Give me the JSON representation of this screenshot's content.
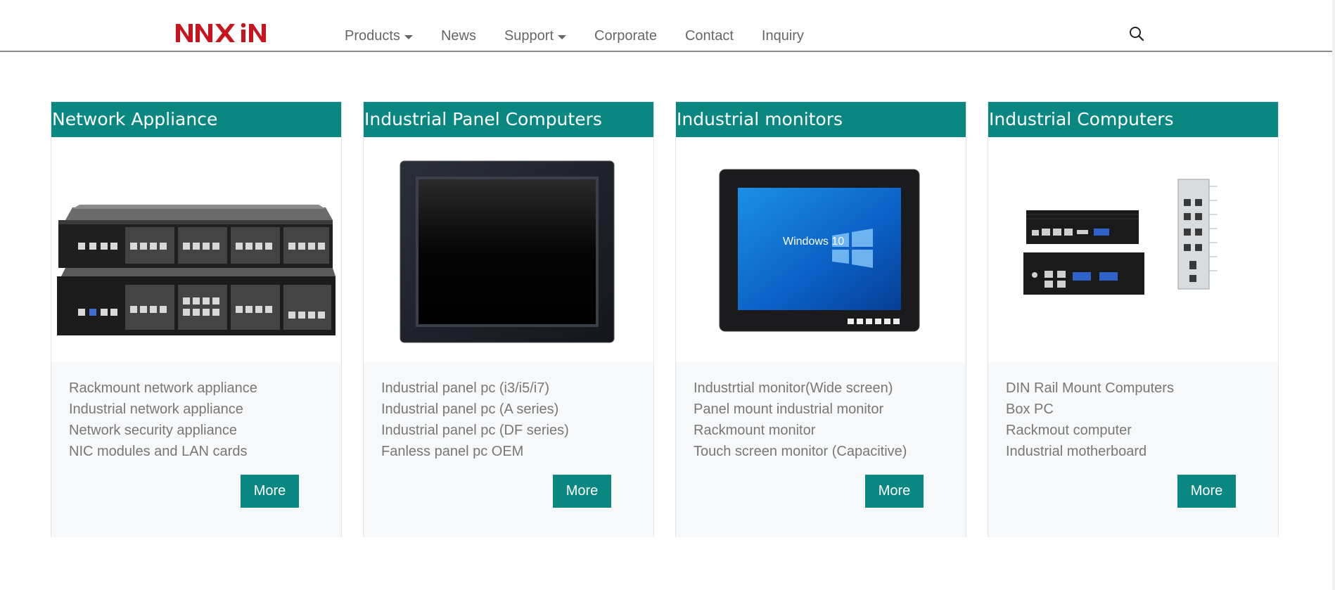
{
  "brand": {
    "logo_text": "ANXIN",
    "accent": "#0a8781",
    "logo_color": "#c8141e"
  },
  "nav": {
    "items": [
      {
        "label": "Products",
        "dropdown": true
      },
      {
        "label": "News",
        "dropdown": false
      },
      {
        "label": "Support",
        "dropdown": true
      },
      {
        "label": "Corporate",
        "dropdown": false
      },
      {
        "label": "Contact",
        "dropdown": false
      },
      {
        "label": "Inquiry",
        "dropdown": false
      }
    ],
    "search_icon": "search-icon"
  },
  "cards": [
    {
      "title": "Network Appliance",
      "image": "rackmount-appliance-image",
      "items": [
        "Rackmount network appliance",
        "Industrial network appliance",
        "Network security appliance",
        "NIC modules and LAN cards"
      ],
      "button": "More"
    },
    {
      "title": "Industrial Panel Computers",
      "image": "panel-pc-image",
      "items": [
        "Industrial panel pc (i3/i5/i7)",
        "Industrial panel pc (A series)",
        "Industrial panel pc (DF series)",
        "Fanless panel pc OEM"
      ],
      "button": "More"
    },
    {
      "title": "Industrial monitors",
      "image": "industrial-monitor-image",
      "screen_text": "Windows 10",
      "items": [
        "Industrtial monitor(Wide screen)",
        "Panel mount industrial monitor",
        "Rackmount monitor",
        "Touch screen monitor (Capacitive)"
      ],
      "button": "More"
    },
    {
      "title": "Industrial Computers",
      "image": "industrial-computers-image",
      "items": [
        "DIN Rail Mount Computers",
        "Box PC",
        "Rackmout computer",
        "Industrial motherboard"
      ],
      "button": "More"
    }
  ]
}
